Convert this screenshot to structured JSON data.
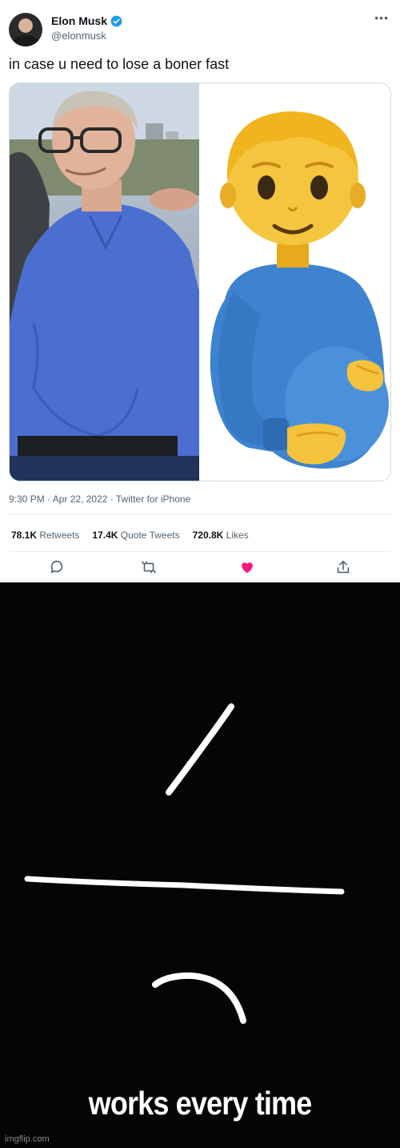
{
  "tweet": {
    "author_name": "Elon Musk",
    "author_handle": "@elonmusk",
    "text": "in case u need to lose a boner fast",
    "meta": "9:30 PM · Apr 22, 2022 · Twitter for iPhone",
    "stats": {
      "retweets_count": "78.1K",
      "retweets_label": "Retweets",
      "quote_count": "17.4K",
      "quote_label": "Quote Tweets",
      "likes_count": "720.8K",
      "likes_label": "Likes"
    },
    "icons": [
      "verified-icon",
      "more-icon",
      "reply-icon",
      "retweet-icon",
      "like-icon",
      "share-icon"
    ],
    "colors": {
      "verified": "#1d9bf0",
      "like": "#f91880",
      "secondary_text": "#536471"
    }
  },
  "meme": {
    "caption": "works every time",
    "watermark": "imgflip.com",
    "background": "#050505"
  }
}
